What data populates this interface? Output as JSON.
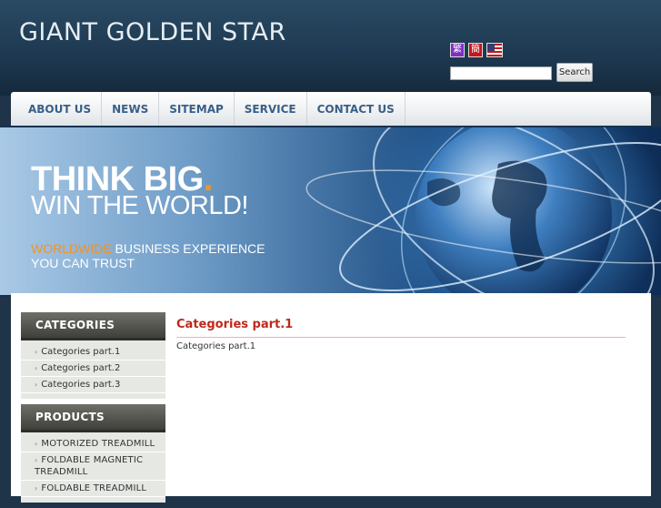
{
  "header": {
    "site_title": "GIANT GOLDEN STAR",
    "lang_flags": [
      {
        "icon": "traditional-chinese-flag-icon",
        "glyph": "繁"
      },
      {
        "icon": "simplified-chinese-flag-icon",
        "glyph": "簡"
      },
      {
        "icon": "us-flag-icon",
        "glyph": ""
      }
    ],
    "search": {
      "value": "",
      "placeholder": "",
      "button_label": "Search"
    }
  },
  "nav": {
    "items": [
      {
        "label": "ABOUT US"
      },
      {
        "label": "NEWS"
      },
      {
        "label": "SITEMAP"
      },
      {
        "label": "SERVICE"
      },
      {
        "label": "CONTACT US"
      }
    ]
  },
  "banner": {
    "title": "THINK BIG",
    "title_dot": ".",
    "subtitle": "WIN THE WORLD!",
    "tagline_highlight": "WORLDWIDE",
    "tagline_rest": " BUSINESS EXPERIENCE",
    "tagline_line2": "YOU CAN TRUST"
  },
  "sidebar": {
    "categories": {
      "header": "CATEGORIES",
      "items": [
        {
          "label": "Categories part.1"
        },
        {
          "label": "Categories part.2"
        },
        {
          "label": "Categories part.3"
        }
      ]
    },
    "products": {
      "header": "PRODUCTS",
      "items": [
        {
          "label": "MOTORIZED TREADMILL"
        },
        {
          "label": "FOLDABLE MAGNETIC TREADMILL"
        },
        {
          "label": "FOLDABLE TREADMILL"
        }
      ]
    }
  },
  "main": {
    "title": "Categories part.1",
    "body": "Categories part.1"
  },
  "colors": {
    "header_bg": "#1f3448",
    "nav_text": "#3a5f86",
    "accent_red": "#c0281a",
    "accent_orange": "#f39321",
    "sidebar_header": "#4a4b45"
  }
}
